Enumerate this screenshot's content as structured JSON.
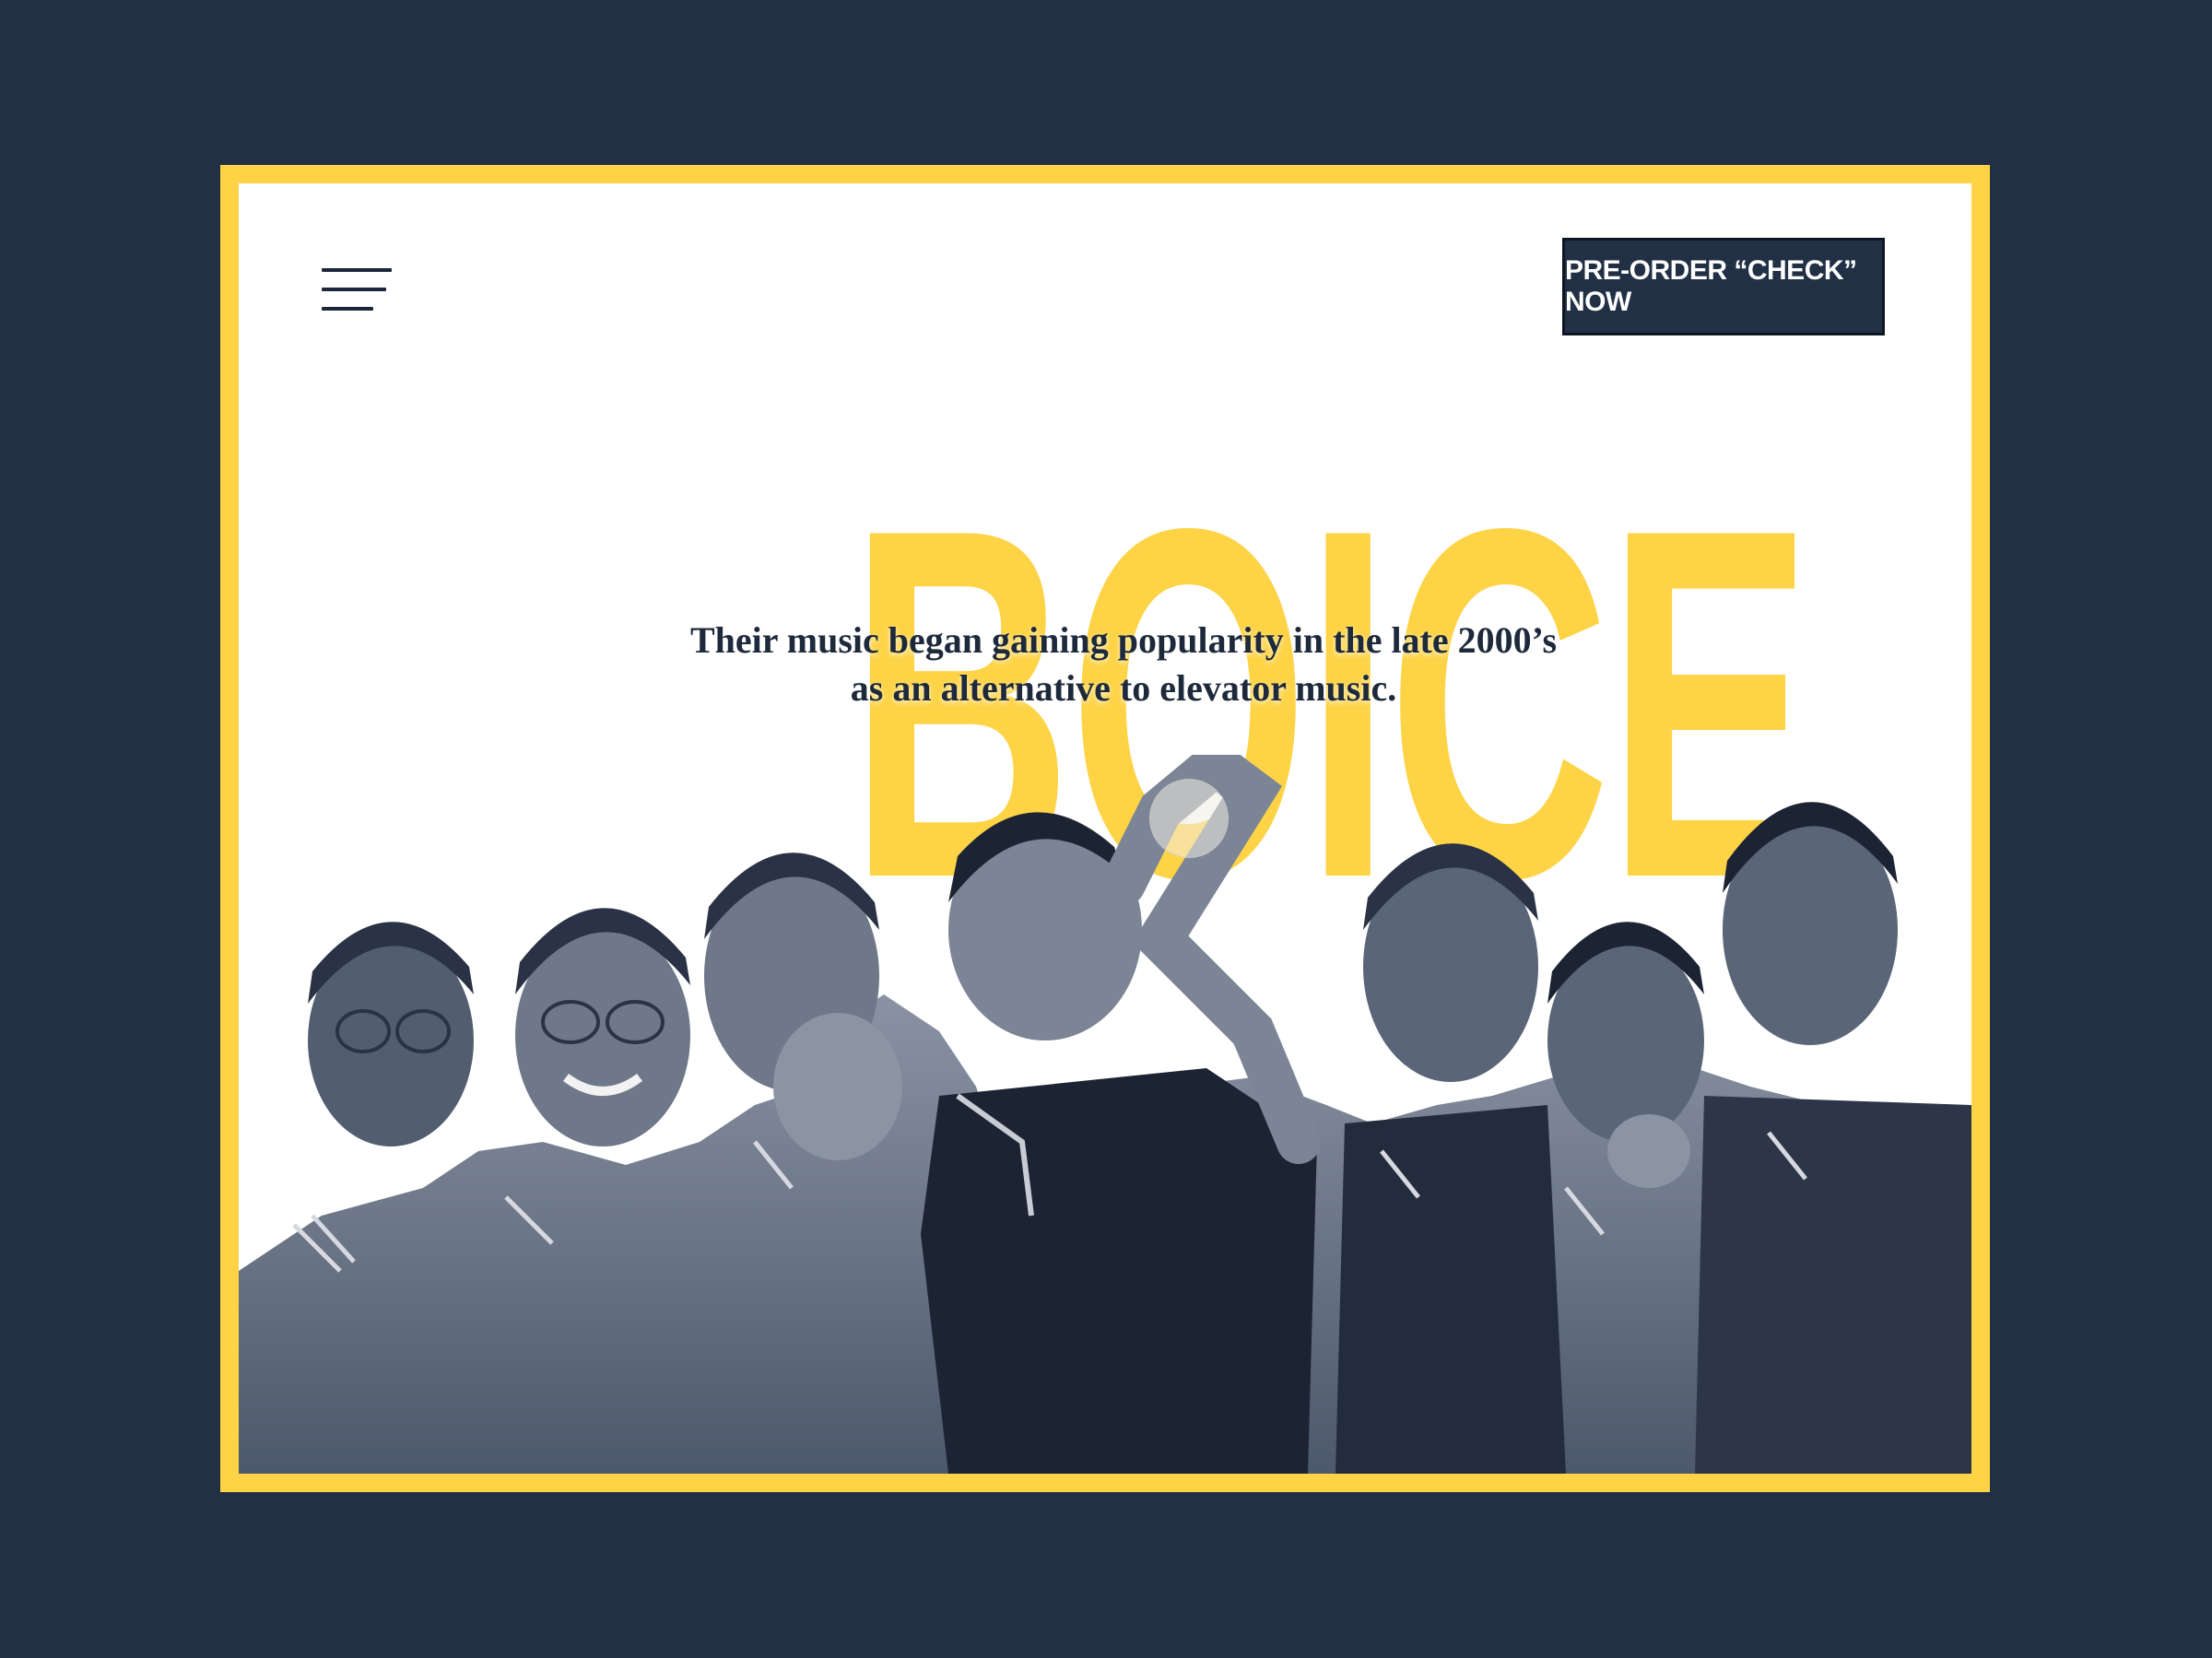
{
  "header": {
    "menu_icon": "hamburger-menu-icon",
    "cta_label": "PRE-ORDER “CHECK” NOW"
  },
  "hero": {
    "brand": "BOICE",
    "tagline": "Their music began gaining popularity in the late 2000’s as an alternative to elevator music."
  },
  "colors": {
    "background": "#213044",
    "frame": "#fed346",
    "brand_text": "#fed346",
    "button": "#213044",
    "tagline": "#1e2a3b"
  }
}
